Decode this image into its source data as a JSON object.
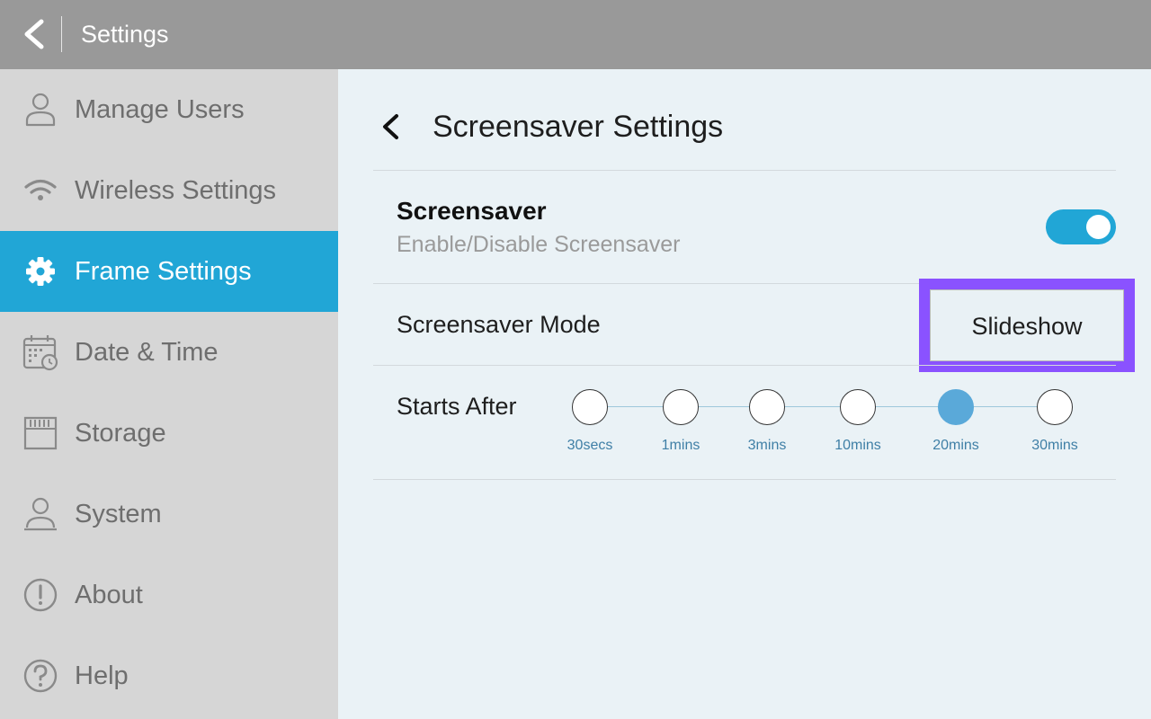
{
  "topbar": {
    "title": "Settings"
  },
  "sidebar": {
    "items": [
      {
        "label": "Manage Users",
        "icon": "user-icon"
      },
      {
        "label": "Wireless Settings",
        "icon": "wifi-icon"
      },
      {
        "label": "Frame Settings",
        "icon": "gear-icon",
        "active": true
      },
      {
        "label": "Date & Time",
        "icon": "calendar-clock-icon"
      },
      {
        "label": "Storage",
        "icon": "sd-card-icon"
      },
      {
        "label": "System",
        "icon": "system-user-icon"
      },
      {
        "label": "About",
        "icon": "info-icon"
      },
      {
        "label": "Help",
        "icon": "help-icon"
      }
    ]
  },
  "panel": {
    "title": "Screensaver Settings",
    "screensaver": {
      "title": "Screensaver",
      "subtitle": "Enable/Disable Screensaver",
      "enabled": true
    },
    "mode": {
      "label": "Screensaver Mode",
      "value": "Slideshow"
    },
    "starts_after": {
      "label": "Starts After",
      "options": [
        "30secs",
        "1mins",
        "3mins",
        "10mins",
        "20mins",
        "30mins"
      ],
      "selected": "20mins"
    }
  },
  "colors": {
    "accent": "#21a6d6",
    "highlight": "#8a52ff",
    "selected_dot": "#5aa9d9",
    "topbar": "#999999",
    "sidebar": "#d6d6d6",
    "content_bg": "#eaf2f6"
  }
}
